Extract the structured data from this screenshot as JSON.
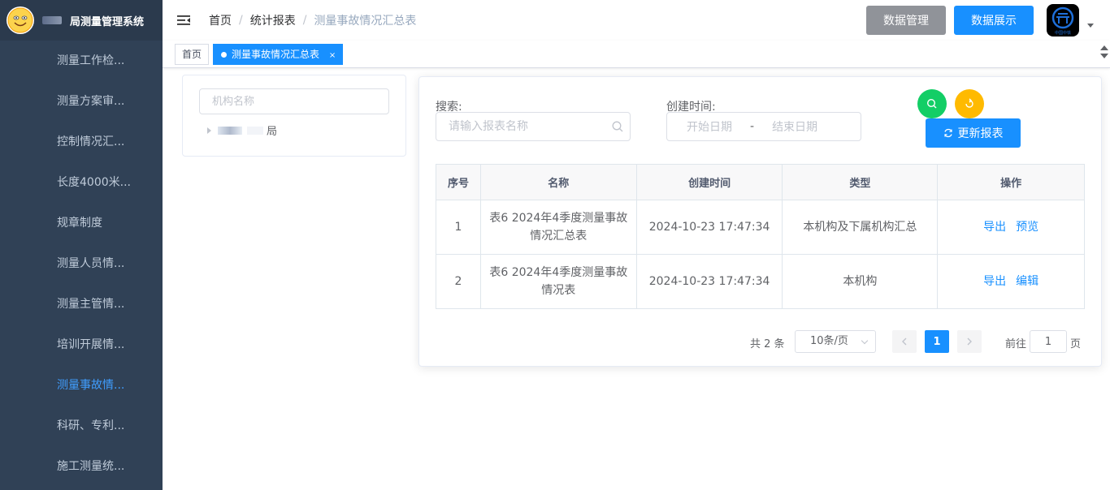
{
  "sidebar": {
    "title": "局测量管理系统",
    "items": [
      {
        "label": "测量工作检..."
      },
      {
        "label": "测量方案审..."
      },
      {
        "label": "控制情况汇..."
      },
      {
        "label": "长度4000米..."
      },
      {
        "label": "规章制度"
      },
      {
        "label": "测量人员情..."
      },
      {
        "label": "测量主管情..."
      },
      {
        "label": "培训开展情..."
      },
      {
        "label": "测量事故情..."
      },
      {
        "label": "科研、专利..."
      },
      {
        "label": "施工测量统..."
      }
    ],
    "active_index": 8
  },
  "breadcrumb": [
    "首页",
    "统计报表",
    "测量事故情况汇总表"
  ],
  "header": {
    "btn_data_manage": "数据管理",
    "btn_data_show": "数据展示",
    "logo_text": "中国中铁"
  },
  "tags": {
    "home": "首页",
    "active": "测量事故情况汇总表",
    "close": "×"
  },
  "tree": {
    "placeholder": "机构名称",
    "node_suffix": "局"
  },
  "search": {
    "label": "搜索:",
    "placeholder": "请输入报表名称",
    "date_label": "创建时间:",
    "start_placeholder": "开始日期",
    "separator": "-",
    "end_placeholder": "结束日期",
    "update_button": "更新报表"
  },
  "table": {
    "headers": [
      "序号",
      "名称",
      "创建时间",
      "类型",
      "操作"
    ],
    "rows": [
      {
        "no": "1",
        "name_line1": "表6 2024年4季度测量事故",
        "name_line2": "情况汇总表",
        "created": "2024-10-23 17:47:34",
        "type": "本机构及下属机构汇总",
        "op1": "导出",
        "op2": "预览"
      },
      {
        "no": "2",
        "name_line1": "表6 2024年4季度测量事故",
        "name_line2": "情况表",
        "created": "2024-10-23 17:47:34",
        "type": "本机构",
        "op1": "导出",
        "op2": "编辑"
      }
    ]
  },
  "pagination": {
    "total": "共 2 条",
    "page_size": "10条/页",
    "current": "1",
    "goto_label": "前往",
    "goto_value": "1",
    "unit": "页"
  },
  "colors": {
    "sidebar_bg": "#304156",
    "primary": "#1890ff",
    "search_circle": "#13ce66",
    "reset_circle": "#ffba00"
  }
}
